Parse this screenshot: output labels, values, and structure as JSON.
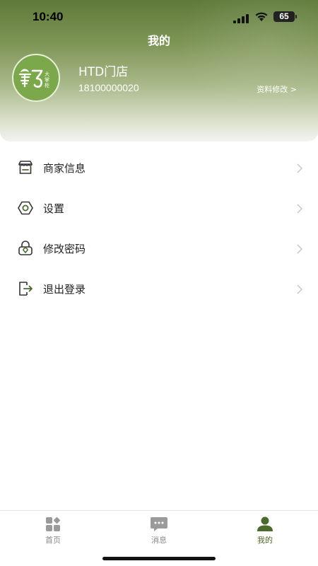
{
  "status_bar": {
    "time": "10:40",
    "battery": "65",
    "icons": [
      "cellular-signal-icon",
      "wifi-icon",
      "battery-icon"
    ]
  },
  "header": {
    "title": "我的",
    "store_name": "HTD门店",
    "phone": "18100000020",
    "edit_profile": "资料修改 >",
    "avatar_logo": "纳乃大掌柜",
    "accent_color": "#6d8a45"
  },
  "menu": [
    {
      "label": "商家信息",
      "icon": "store-icon"
    },
    {
      "label": "设置",
      "icon": "settings-icon"
    },
    {
      "label": "修改密码",
      "icon": "lock-icon"
    },
    {
      "label": "退出登录",
      "icon": "logout-icon"
    }
  ],
  "tabbar": {
    "tabs": [
      {
        "label": "首页",
        "icon": "home-grid-icon",
        "active": false
      },
      {
        "label": "消息",
        "icon": "message-icon",
        "active": false
      },
      {
        "label": "我的",
        "icon": "profile-icon",
        "active": true
      }
    ],
    "active_color": "#4d6a2e",
    "inactive_color": "#8a8a8a"
  }
}
